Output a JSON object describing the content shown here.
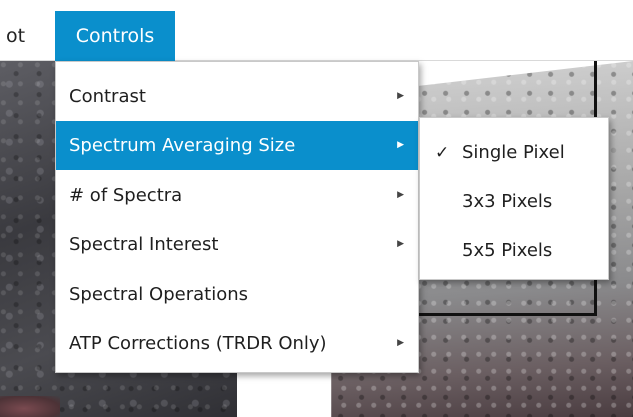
{
  "menubar": {
    "partial_item": "ot",
    "active_item": "Controls"
  },
  "controls_menu": {
    "items": [
      {
        "label": "Contrast",
        "has_submenu": true,
        "highlighted": false
      },
      {
        "label": "Spectrum Averaging Size",
        "has_submenu": true,
        "highlighted": true
      },
      {
        "label": "# of Spectra",
        "has_submenu": true,
        "highlighted": false
      },
      {
        "label": "Spectral Interest",
        "has_submenu": true,
        "highlighted": false
      },
      {
        "label": "Spectral Operations",
        "has_submenu": false,
        "highlighted": false
      },
      {
        "label": "ATP Corrections (TRDR Only)",
        "has_submenu": true,
        "highlighted": false
      }
    ],
    "submenu_arrow_icon": "chevron-right-icon"
  },
  "averaging_submenu": {
    "items": [
      {
        "label": "Single Pixel",
        "checked": true
      },
      {
        "label": "3x3 Pixels",
        "checked": false
      },
      {
        "label": "5x5 Pixels",
        "checked": false
      }
    ],
    "check_icon": "checkmark-icon",
    "check_glyph": "✓"
  },
  "colors": {
    "accent": "#0a8fcc",
    "menu_background": "#ffffff",
    "menu_text": "#1f1f1f"
  }
}
